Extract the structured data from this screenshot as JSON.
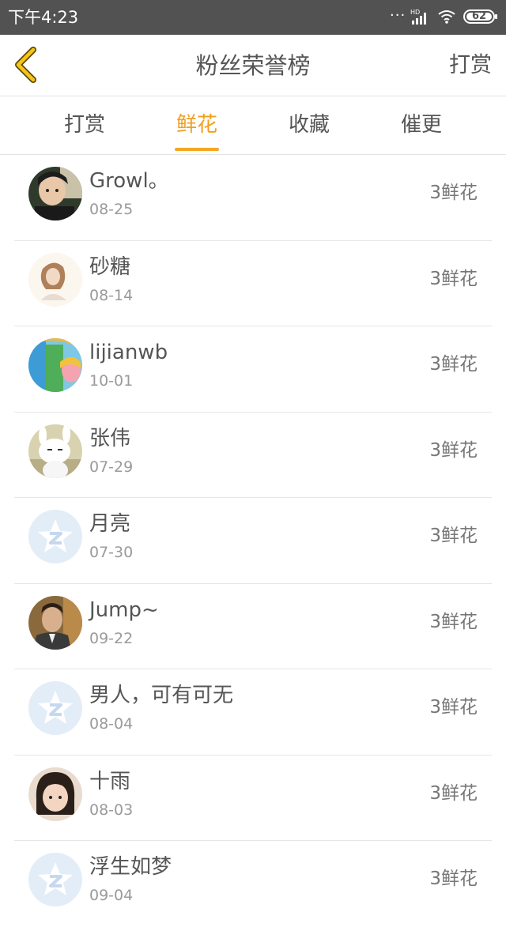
{
  "status_bar": {
    "time": "下午4:23",
    "battery_level": "62",
    "network": "HD"
  },
  "header": {
    "title": "粉丝荣誉榜",
    "action_label": "打赏",
    "back_icon": "chevron-left-icon",
    "accent_color": "#f5a623"
  },
  "tabs": [
    {
      "label": "打赏",
      "active": false
    },
    {
      "label": "鲜花",
      "active": true
    },
    {
      "label": "收藏",
      "active": false
    },
    {
      "label": "催更",
      "active": false
    }
  ],
  "fans": [
    {
      "name": "Growl。",
      "date": "08-25",
      "amount": "3鲜花",
      "avatar": "photo-dark"
    },
    {
      "name": "砂糖",
      "date": "08-14",
      "amount": "3鲜花",
      "avatar": "photo-girl-light"
    },
    {
      "name": "lijianwb",
      "date": "10-01",
      "amount": "3鲜花",
      "avatar": "illustration-colorful"
    },
    {
      "name": "张伟",
      "date": "07-29",
      "amount": "3鲜花",
      "avatar": "white-rabbit"
    },
    {
      "name": "月亮",
      "date": "07-30",
      "amount": "3鲜花",
      "avatar": "default-star"
    },
    {
      "name": "Jump~",
      "date": "09-22",
      "amount": "3鲜花",
      "avatar": "photo-man"
    },
    {
      "name": "男人，可有可无",
      "date": "08-04",
      "amount": "3鲜花",
      "avatar": "default-star"
    },
    {
      "name": "十雨",
      "date": "08-03",
      "amount": "3鲜花",
      "avatar": "photo-child"
    },
    {
      "name": "浮生如梦",
      "date": "09-04",
      "amount": "3鲜花",
      "avatar": "default-star"
    }
  ]
}
